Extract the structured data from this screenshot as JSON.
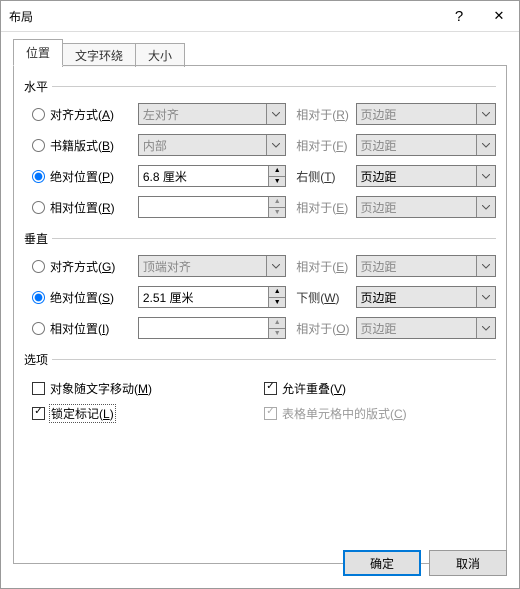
{
  "window": {
    "title": "布局"
  },
  "icons": {
    "help": "?",
    "close": "✕"
  },
  "tabs": {
    "position": "位置",
    "wrap": "文字环绕",
    "size": "大小"
  },
  "sections": {
    "horizontal": "水平",
    "vertical": "垂直",
    "options": "选项"
  },
  "horiz": {
    "align": {
      "label_pre": "对齐方式(",
      "hot": "A",
      "label_post": ")",
      "value": "左对齐",
      "rel_pre": "相对于(",
      "rel_hot": "R",
      "rel_post": ")",
      "rel_value": "页边距"
    },
    "book": {
      "label_pre": "书籍版式(",
      "hot": "B",
      "label_post": ")",
      "value": "内部",
      "rel_pre": "相对于(",
      "rel_hot": "F",
      "rel_post": ")",
      "rel_value": "页边距"
    },
    "abs": {
      "label_pre": "绝对位置(",
      "hot": "P",
      "label_post": ")",
      "value": "6.8 厘米",
      "rel_pre": "右侧(",
      "rel_hot": "T",
      "rel_post": ")",
      "rel_value": "页边距"
    },
    "rel": {
      "label_pre": "相对位置(",
      "hot": "R",
      "label_post": ")",
      "value": "",
      "rel_pre": "相对于(",
      "rel_hot": "E",
      "rel_post": ")",
      "rel_value": "页边距"
    }
  },
  "vert": {
    "align": {
      "label_pre": "对齐方式(",
      "hot": "G",
      "label_post": ")",
      "value": "顶端对齐",
      "rel_pre": "相对于(",
      "rel_hot": "E",
      "rel_post": ")",
      "rel_value": "页边距"
    },
    "abs": {
      "label_pre": "绝对位置(",
      "hot": "S",
      "label_post": ")",
      "value": "2.51 厘米",
      "rel_pre": "下侧(",
      "rel_hot": "W",
      "rel_post": ")",
      "rel_value": "页边距"
    },
    "rel": {
      "label_pre": "相对位置(",
      "hot": "I",
      "label_post": ")",
      "value": "",
      "rel_pre": "相对于(",
      "rel_hot": "O",
      "rel_post": ")",
      "rel_value": "页边距"
    }
  },
  "options": {
    "move_with_text": {
      "pre": "对象随文字移动(",
      "hot": "M",
      "post": ")"
    },
    "lock_anchor": {
      "pre": "锁定标记(",
      "hot": "L",
      "post": ")"
    },
    "allow_overlap": {
      "pre": "允许重叠(",
      "hot": "V",
      "post": ")"
    },
    "layout_in_cell": {
      "pre": "表格单元格中的版式(",
      "hot": "C",
      "post": ")"
    }
  },
  "buttons": {
    "ok": "确定",
    "cancel": "取消"
  }
}
